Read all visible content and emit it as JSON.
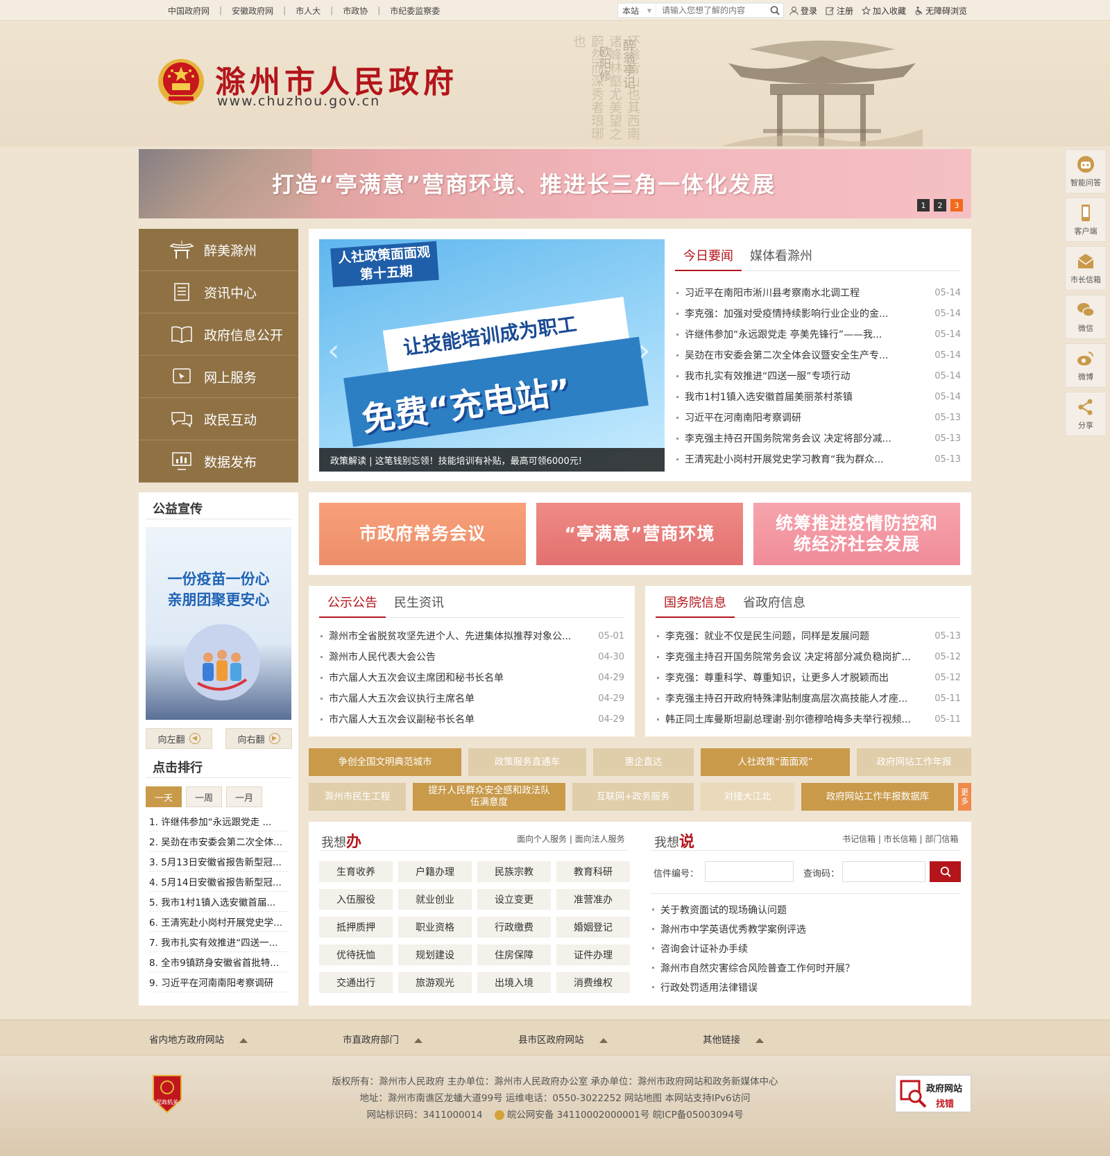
{
  "topbar": {
    "links": [
      "中国政府网",
      "安徽政府网",
      "市人大",
      "市政协",
      "市纪委监察委"
    ],
    "search_scope": "本站",
    "search_placeholder": "请输入您想了解的内容",
    "actions": [
      "登录",
      "注册",
      "加入收藏",
      "无障碍浏览"
    ]
  },
  "header": {
    "title": "滁州市人民政府",
    "url": "www.chuzhou.gov.cn",
    "poem_vertical": "环滁皆山也其西南诸峰林壑尤美望之蔚然而深秀者琅琊也",
    "poem_author": "欧阳修",
    "poem_title": "醉翁亭记"
  },
  "banner": {
    "text": "打造“亭满意”营商环境、推进长三角一体化发展",
    "dots": [
      "1",
      "2",
      "3"
    ]
  },
  "side_float": [
    "智能问答",
    "客户端",
    "市长信箱",
    "微信",
    "微博",
    "分享"
  ],
  "leftnav": [
    "醉美滁州",
    "资讯中心",
    "政府信息公开",
    "网上服务",
    "政民互动",
    "数据发布"
  ],
  "slide": {
    "line1": "人社政策面面观",
    "line2": "第十五期",
    "line3": "让技能培训成为职工",
    "line4": "免费“充电站”",
    "caption": "政策解读 | 这笔钱别忘领！技能培训有补贴，最高可领6000元!"
  },
  "today_news": {
    "tabs": [
      "今日要闻",
      "媒体看滁州"
    ],
    "items": [
      {
        "title": "习近平在南阳市淅川县考察南水北调工程",
        "date": "05-14"
      },
      {
        "title": "李克强：加强对受疫情持续影响行业企业的金...",
        "date": "05-14"
      },
      {
        "title": "许继伟参加“永远跟党走 亭美先锋行”——我...",
        "date": "05-14"
      },
      {
        "title": "吴劲在市安委会第二次全体会议暨安全生产专...",
        "date": "05-14"
      },
      {
        "title": "我市扎实有效推进“四送一服”专项行动",
        "date": "05-14"
      },
      {
        "title": "我市1村1镇入选安徽首届美丽茶村茶镇",
        "date": "05-14"
      },
      {
        "title": "习近平在河南南阳考察调研",
        "date": "05-13"
      },
      {
        "title": "李克强主持召开国务院常务会议 决定将部分减...",
        "date": "05-13"
      },
      {
        "title": "王清宪赴小岗村开展党史学习教育“我为群众...",
        "date": "05-13"
      }
    ]
  },
  "public": {
    "title": "公益宣传",
    "poster_line1": "一份疫苗一份心",
    "poster_line2": "亲朋团聚更安心",
    "prev": "向左翻",
    "next": "向右翻"
  },
  "ranking": {
    "title": "点击排行",
    "tabs": [
      "一天",
      "一周",
      "一月"
    ],
    "items": [
      "1. 许继伟参加“永远跟党走 ...",
      "2. 吴劲在市安委会第二次全体...",
      "3. 5月13日安徽省报告新型冠...",
      "4. 5月14日安徽省报告新型冠...",
      "5. 我市1村1镇入选安徽首届...",
      "6. 王清宪赴小岗村开展党史学...",
      "7. 我市扎实有效推进“四送一...",
      "8. 全市9镇跻身安徽省首批特...",
      "9. 习近平在河南南阳考察调研"
    ]
  },
  "tiles": [
    "市政府常务会议",
    "“亭满意”营商环境",
    "统筹推进疫情防控和统经济社会发展"
  ],
  "notice": {
    "tabs": [
      "公示公告",
      "民生资讯"
    ],
    "items": [
      {
        "title": "滁州市全省脱贫攻坚先进个人、先进集体拟推荐对象公...",
        "date": "05-01"
      },
      {
        "title": "滁州市人民代表大会公告",
        "date": "04-30"
      },
      {
        "title": "市六届人大五次会议主席团和秘书长名单",
        "date": "04-29"
      },
      {
        "title": "市六届人大五次会议执行主席名单",
        "date": "04-29"
      },
      {
        "title": "市六届人大五次会议副秘书长名单",
        "date": "04-29"
      }
    ]
  },
  "state_council": {
    "tabs": [
      "国务院信息",
      "省政府信息"
    ],
    "items": [
      {
        "title": "李克强：就业不仅是民生问题，同样是发展问题",
        "date": "05-13"
      },
      {
        "title": "李克强主持召开国务院常务会议 决定将部分减负稳岗扩...",
        "date": "05-12"
      },
      {
        "title": "李克强：尊重科学、尊重知识，让更多人才脱颖而出",
        "date": "05-12"
      },
      {
        "title": "李克强主持召开政府特殊津贴制度高层次高技能人才座...",
        "date": "05-11"
      },
      {
        "title": "韩正同土库曼斯坦副总理谢·别尔德穆哈梅多夫举行视频...",
        "date": "05-11"
      }
    ]
  },
  "categories": {
    "row1": [
      "争创全国文明典范城市",
      "政策服务直通车",
      "惠企直达",
      "人社政策“面面观”",
      "政府网站工作年报"
    ],
    "row2": [
      "滁州市民生工程",
      "提升人民群众安全感和政法队伍满意度",
      "互联网+政务服务",
      "对接大江北",
      "政府网站工作年报数据库"
    ],
    "more": "更多"
  },
  "want_do": {
    "title_a": "我想",
    "title_b": "办",
    "links": "面向个人服务 | 面向法人服务",
    "services": [
      "生育收养",
      "户籍办理",
      "民族宗教",
      "教育科研",
      "入伍服役",
      "就业创业",
      "设立变更",
      "准营准办",
      "抵押质押",
      "职业资格",
      "行政缴费",
      "婚姻登记",
      "优待抚恤",
      "规划建设",
      "住房保障",
      "证件办理",
      "交通出行",
      "旅游观光",
      "出境入境",
      "消费维权"
    ]
  },
  "want_say": {
    "title_a": "我想",
    "title_b": "说",
    "links": "书记信箱 | 市长信箱 | 部门信箱",
    "letter_no": "信件编号：",
    "query_code": "查询码：",
    "items": [
      "关于教资面试的现场确认问题",
      "滁州市中学英语优秀教学案例评选",
      "咨询会计证补办手续",
      "滁州市自然灾害综合风险普查工作何时开展？",
      "行政处罚适用法律错误"
    ]
  },
  "footer_links": [
    "省内地方政府网站",
    "市直政府部门",
    "县市区政府网站",
    "其他链接"
  ],
  "footer": {
    "line1": "版权所有：滁州市人民政府    主办单位：滁州市人民政府办公室    承办单位：滁州市政府网站和政务新媒体中心",
    "line2": "地址：滁州市南谯区龙蟠大道99号    运维电话：0550-3022252    网站地图    本网站支持IPv6访问",
    "line3_a": "网站标识码：3411000014",
    "line3_b": "皖公网安备 34110002000001号    皖ICP备05003094号",
    "badge": "党政机关",
    "jiucuo_1": "政府网站",
    "jiucuo_2": "找错"
  },
  "colors": {
    "brand_red": "#b3151b",
    "gold": "#c89a4a",
    "nav_brown": "#8f7144"
  }
}
